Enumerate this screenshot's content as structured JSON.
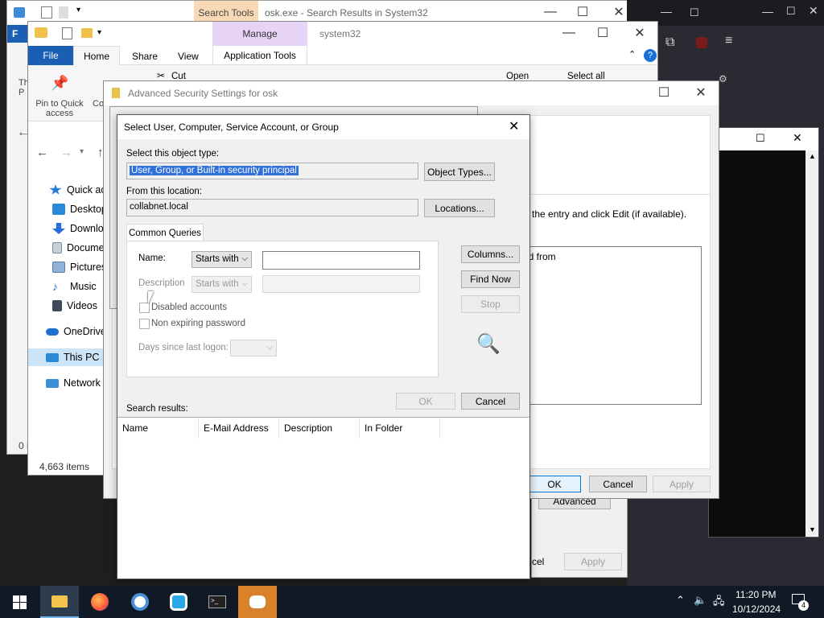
{
  "search_window": {
    "title": "osk.exe - Search Results in System32",
    "context_tab": "Search Tools"
  },
  "explorer": {
    "title": "system32",
    "ribbon_tabs": [
      "File",
      "Home",
      "Share",
      "View",
      "Application Tools"
    ],
    "manage_label": "Manage",
    "pin_label": "Pin to Quick access",
    "copy_label": "Co",
    "cut_label": "Cut",
    "open_label": "Open",
    "select_all_label": "Select all",
    "nav_items": [
      {
        "label": "Quick acc",
        "icon": "star-icon",
        "color": "#2b79d8"
      },
      {
        "label": "Desktop",
        "icon": "desktop-icon",
        "color": "#2b8ad8"
      },
      {
        "label": "Downlo",
        "icon": "download-icon",
        "color": "#2b6cd8"
      },
      {
        "label": "Docume",
        "icon": "documents-icon",
        "color": "#7a8aa0"
      },
      {
        "label": "Pictures",
        "icon": "pictures-icon",
        "color": "#5a7aa8"
      },
      {
        "label": "Music",
        "icon": "music-icon",
        "color": "#1e6fd0"
      },
      {
        "label": "Videos",
        "icon": "videos-icon",
        "color": "#404a5a"
      },
      {
        "label": "OneDrive",
        "icon": "onedrive-icon",
        "color": "#1f6fd0"
      },
      {
        "label": "This PC",
        "icon": "this-pc-icon",
        "color": "#2b8ad8"
      },
      {
        "label": "Network",
        "icon": "network-icon",
        "color": "#3a8fd8"
      }
    ],
    "status_items": "4,663 items",
    "left_status": "0 i"
  },
  "adv_security": {
    "title": "Advanced Security Settings for osk",
    "instruction": "the entry and click Edit (if available).",
    "inherited_label": "ed from",
    "ok_label": "OK",
    "cancel_label": "Cancel",
    "apply_label": "Apply",
    "advanced_label": "Advanced",
    "back_cancel_label": "cel",
    "back_apply_label": "Apply"
  },
  "dialog": {
    "title": "Select User, Computer, Service Account, or Group",
    "object_type_label": "Select this object type:",
    "object_type_value": "User, Group, or Built-in security principal",
    "object_types_button": "Object Types...",
    "location_label": "From this location:",
    "location_value": "collabnet.local",
    "locations_button": "Locations...",
    "tab_label": "Common Queries",
    "name_label": "Name:",
    "name_combo": "Starts with",
    "name_value": "",
    "description_label": "Description",
    "description_combo": "Starts with",
    "disabled_accounts": "Disabled accounts",
    "non_expiring": "Non expiring password",
    "days_label": "Days since last logon:",
    "columns_button": "Columns...",
    "find_now_button": "Find Now",
    "stop_button": "Stop",
    "ok_button": "OK",
    "cancel_button": "Cancel",
    "results_label": "Search results:",
    "columns": [
      "Name",
      "E-Mail Address",
      "Description",
      "In Folder"
    ]
  },
  "taskbar": {
    "time": "11:20 PM",
    "date": "10/12/2024",
    "notification_count": "4"
  }
}
